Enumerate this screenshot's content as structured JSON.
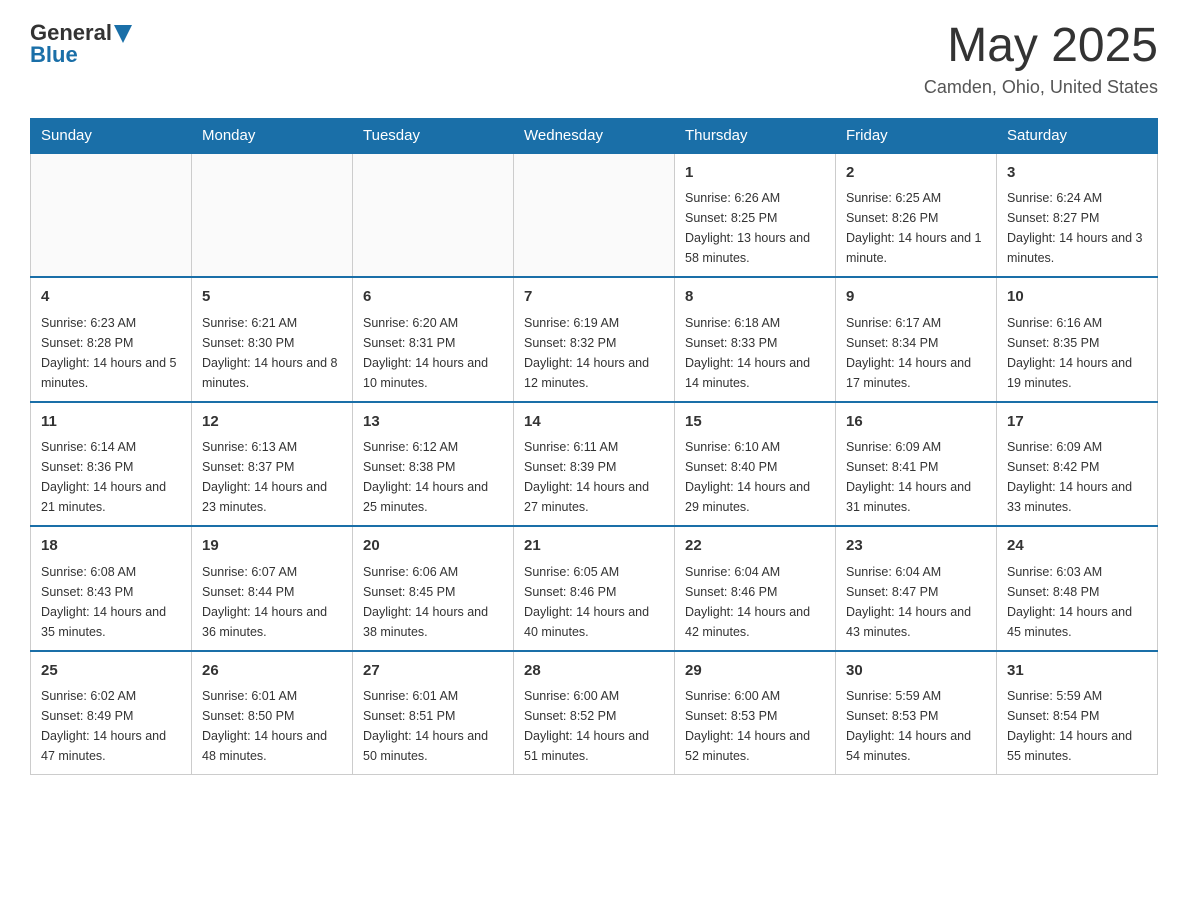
{
  "header": {
    "logo": {
      "general": "General",
      "blue": "Blue"
    },
    "title": "May 2025",
    "location": "Camden, Ohio, United States"
  },
  "days_of_week": [
    "Sunday",
    "Monday",
    "Tuesday",
    "Wednesday",
    "Thursday",
    "Friday",
    "Saturday"
  ],
  "weeks": [
    [
      {
        "day": "",
        "info": ""
      },
      {
        "day": "",
        "info": ""
      },
      {
        "day": "",
        "info": ""
      },
      {
        "day": "",
        "info": ""
      },
      {
        "day": "1",
        "info": "Sunrise: 6:26 AM\nSunset: 8:25 PM\nDaylight: 13 hours\nand 58 minutes."
      },
      {
        "day": "2",
        "info": "Sunrise: 6:25 AM\nSunset: 8:26 PM\nDaylight: 14 hours\nand 1 minute."
      },
      {
        "day": "3",
        "info": "Sunrise: 6:24 AM\nSunset: 8:27 PM\nDaylight: 14 hours\nand 3 minutes."
      }
    ],
    [
      {
        "day": "4",
        "info": "Sunrise: 6:23 AM\nSunset: 8:28 PM\nDaylight: 14 hours\nand 5 minutes."
      },
      {
        "day": "5",
        "info": "Sunrise: 6:21 AM\nSunset: 8:30 PM\nDaylight: 14 hours\nand 8 minutes."
      },
      {
        "day": "6",
        "info": "Sunrise: 6:20 AM\nSunset: 8:31 PM\nDaylight: 14 hours\nand 10 minutes."
      },
      {
        "day": "7",
        "info": "Sunrise: 6:19 AM\nSunset: 8:32 PM\nDaylight: 14 hours\nand 12 minutes."
      },
      {
        "day": "8",
        "info": "Sunrise: 6:18 AM\nSunset: 8:33 PM\nDaylight: 14 hours\nand 14 minutes."
      },
      {
        "day": "9",
        "info": "Sunrise: 6:17 AM\nSunset: 8:34 PM\nDaylight: 14 hours\nand 17 minutes."
      },
      {
        "day": "10",
        "info": "Sunrise: 6:16 AM\nSunset: 8:35 PM\nDaylight: 14 hours\nand 19 minutes."
      }
    ],
    [
      {
        "day": "11",
        "info": "Sunrise: 6:14 AM\nSunset: 8:36 PM\nDaylight: 14 hours\nand 21 minutes."
      },
      {
        "day": "12",
        "info": "Sunrise: 6:13 AM\nSunset: 8:37 PM\nDaylight: 14 hours\nand 23 minutes."
      },
      {
        "day": "13",
        "info": "Sunrise: 6:12 AM\nSunset: 8:38 PM\nDaylight: 14 hours\nand 25 minutes."
      },
      {
        "day": "14",
        "info": "Sunrise: 6:11 AM\nSunset: 8:39 PM\nDaylight: 14 hours\nand 27 minutes."
      },
      {
        "day": "15",
        "info": "Sunrise: 6:10 AM\nSunset: 8:40 PM\nDaylight: 14 hours\nand 29 minutes."
      },
      {
        "day": "16",
        "info": "Sunrise: 6:09 AM\nSunset: 8:41 PM\nDaylight: 14 hours\nand 31 minutes."
      },
      {
        "day": "17",
        "info": "Sunrise: 6:09 AM\nSunset: 8:42 PM\nDaylight: 14 hours\nand 33 minutes."
      }
    ],
    [
      {
        "day": "18",
        "info": "Sunrise: 6:08 AM\nSunset: 8:43 PM\nDaylight: 14 hours\nand 35 minutes."
      },
      {
        "day": "19",
        "info": "Sunrise: 6:07 AM\nSunset: 8:44 PM\nDaylight: 14 hours\nand 36 minutes."
      },
      {
        "day": "20",
        "info": "Sunrise: 6:06 AM\nSunset: 8:45 PM\nDaylight: 14 hours\nand 38 minutes."
      },
      {
        "day": "21",
        "info": "Sunrise: 6:05 AM\nSunset: 8:46 PM\nDaylight: 14 hours\nand 40 minutes."
      },
      {
        "day": "22",
        "info": "Sunrise: 6:04 AM\nSunset: 8:46 PM\nDaylight: 14 hours\nand 42 minutes."
      },
      {
        "day": "23",
        "info": "Sunrise: 6:04 AM\nSunset: 8:47 PM\nDaylight: 14 hours\nand 43 minutes."
      },
      {
        "day": "24",
        "info": "Sunrise: 6:03 AM\nSunset: 8:48 PM\nDaylight: 14 hours\nand 45 minutes."
      }
    ],
    [
      {
        "day": "25",
        "info": "Sunrise: 6:02 AM\nSunset: 8:49 PM\nDaylight: 14 hours\nand 47 minutes."
      },
      {
        "day": "26",
        "info": "Sunrise: 6:01 AM\nSunset: 8:50 PM\nDaylight: 14 hours\nand 48 minutes."
      },
      {
        "day": "27",
        "info": "Sunrise: 6:01 AM\nSunset: 8:51 PM\nDaylight: 14 hours\nand 50 minutes."
      },
      {
        "day": "28",
        "info": "Sunrise: 6:00 AM\nSunset: 8:52 PM\nDaylight: 14 hours\nand 51 minutes."
      },
      {
        "day": "29",
        "info": "Sunrise: 6:00 AM\nSunset: 8:53 PM\nDaylight: 14 hours\nand 52 minutes."
      },
      {
        "day": "30",
        "info": "Sunrise: 5:59 AM\nSunset: 8:53 PM\nDaylight: 14 hours\nand 54 minutes."
      },
      {
        "day": "31",
        "info": "Sunrise: 5:59 AM\nSunset: 8:54 PM\nDaylight: 14 hours\nand 55 minutes."
      }
    ]
  ]
}
